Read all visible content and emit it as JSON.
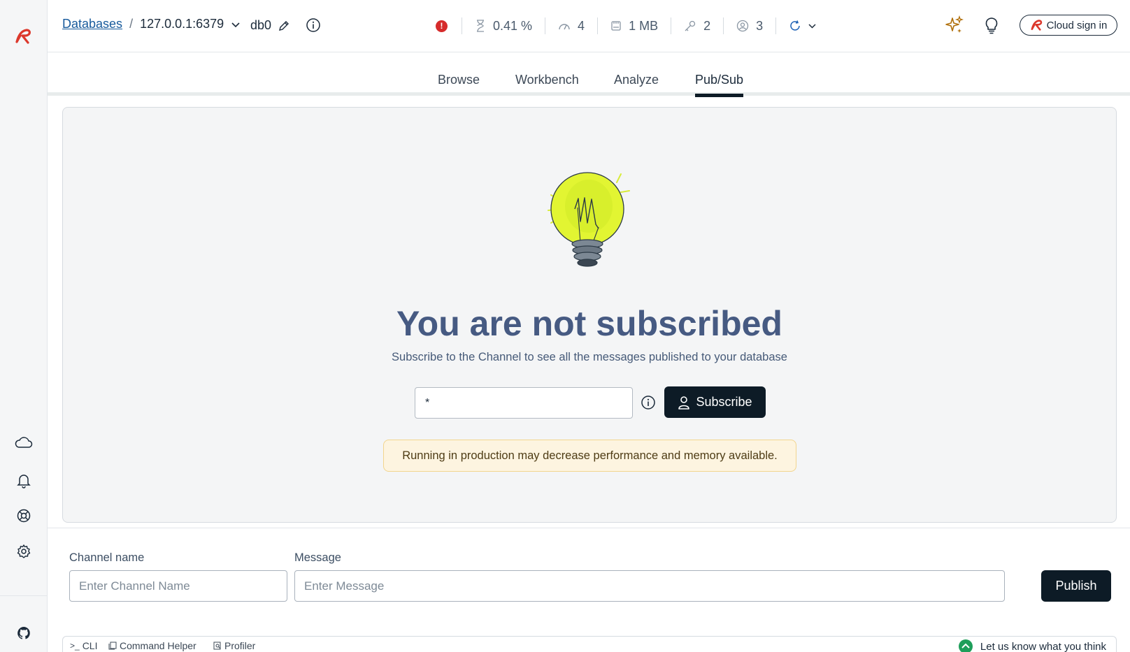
{
  "header": {
    "breadcrumb_root": "Databases",
    "breadcrumb_sep": "/",
    "host": "127.0.0.1:6379",
    "db_name": "db0",
    "stats": {
      "cpu": "0.41 %",
      "ops": "4",
      "memory": "1 MB",
      "keys": "2",
      "clients": "3"
    },
    "cloud_signin_label": "Cloud sign in"
  },
  "tabs": [
    {
      "label": "Browse",
      "active": false
    },
    {
      "label": "Workbench",
      "active": false
    },
    {
      "label": "Analyze",
      "active": false
    },
    {
      "label": "Pub/Sub",
      "active": true
    }
  ],
  "main": {
    "headline": "You are not subscribed",
    "subline": "Subscribe to the Channel to see all the messages published to your database",
    "pattern_value": "*",
    "subscribe_label": "Subscribe",
    "warning": "Running in production may decrease performance and memory available."
  },
  "publish": {
    "channel_label": "Channel name",
    "channel_placeholder": "Enter Channel Name",
    "message_label": "Message",
    "message_placeholder": "Enter Message",
    "publish_label": "Publish"
  },
  "bottom": {
    "cli": "CLI",
    "command_helper": "Command Helper",
    "profiler": "Profiler",
    "feedback": "Let us know what you think"
  },
  "colors": {
    "brand_red": "#dc382c",
    "primary_dark": "#0d1b26",
    "headline": "#465a82",
    "warning_bg": "#fdf4e0"
  }
}
